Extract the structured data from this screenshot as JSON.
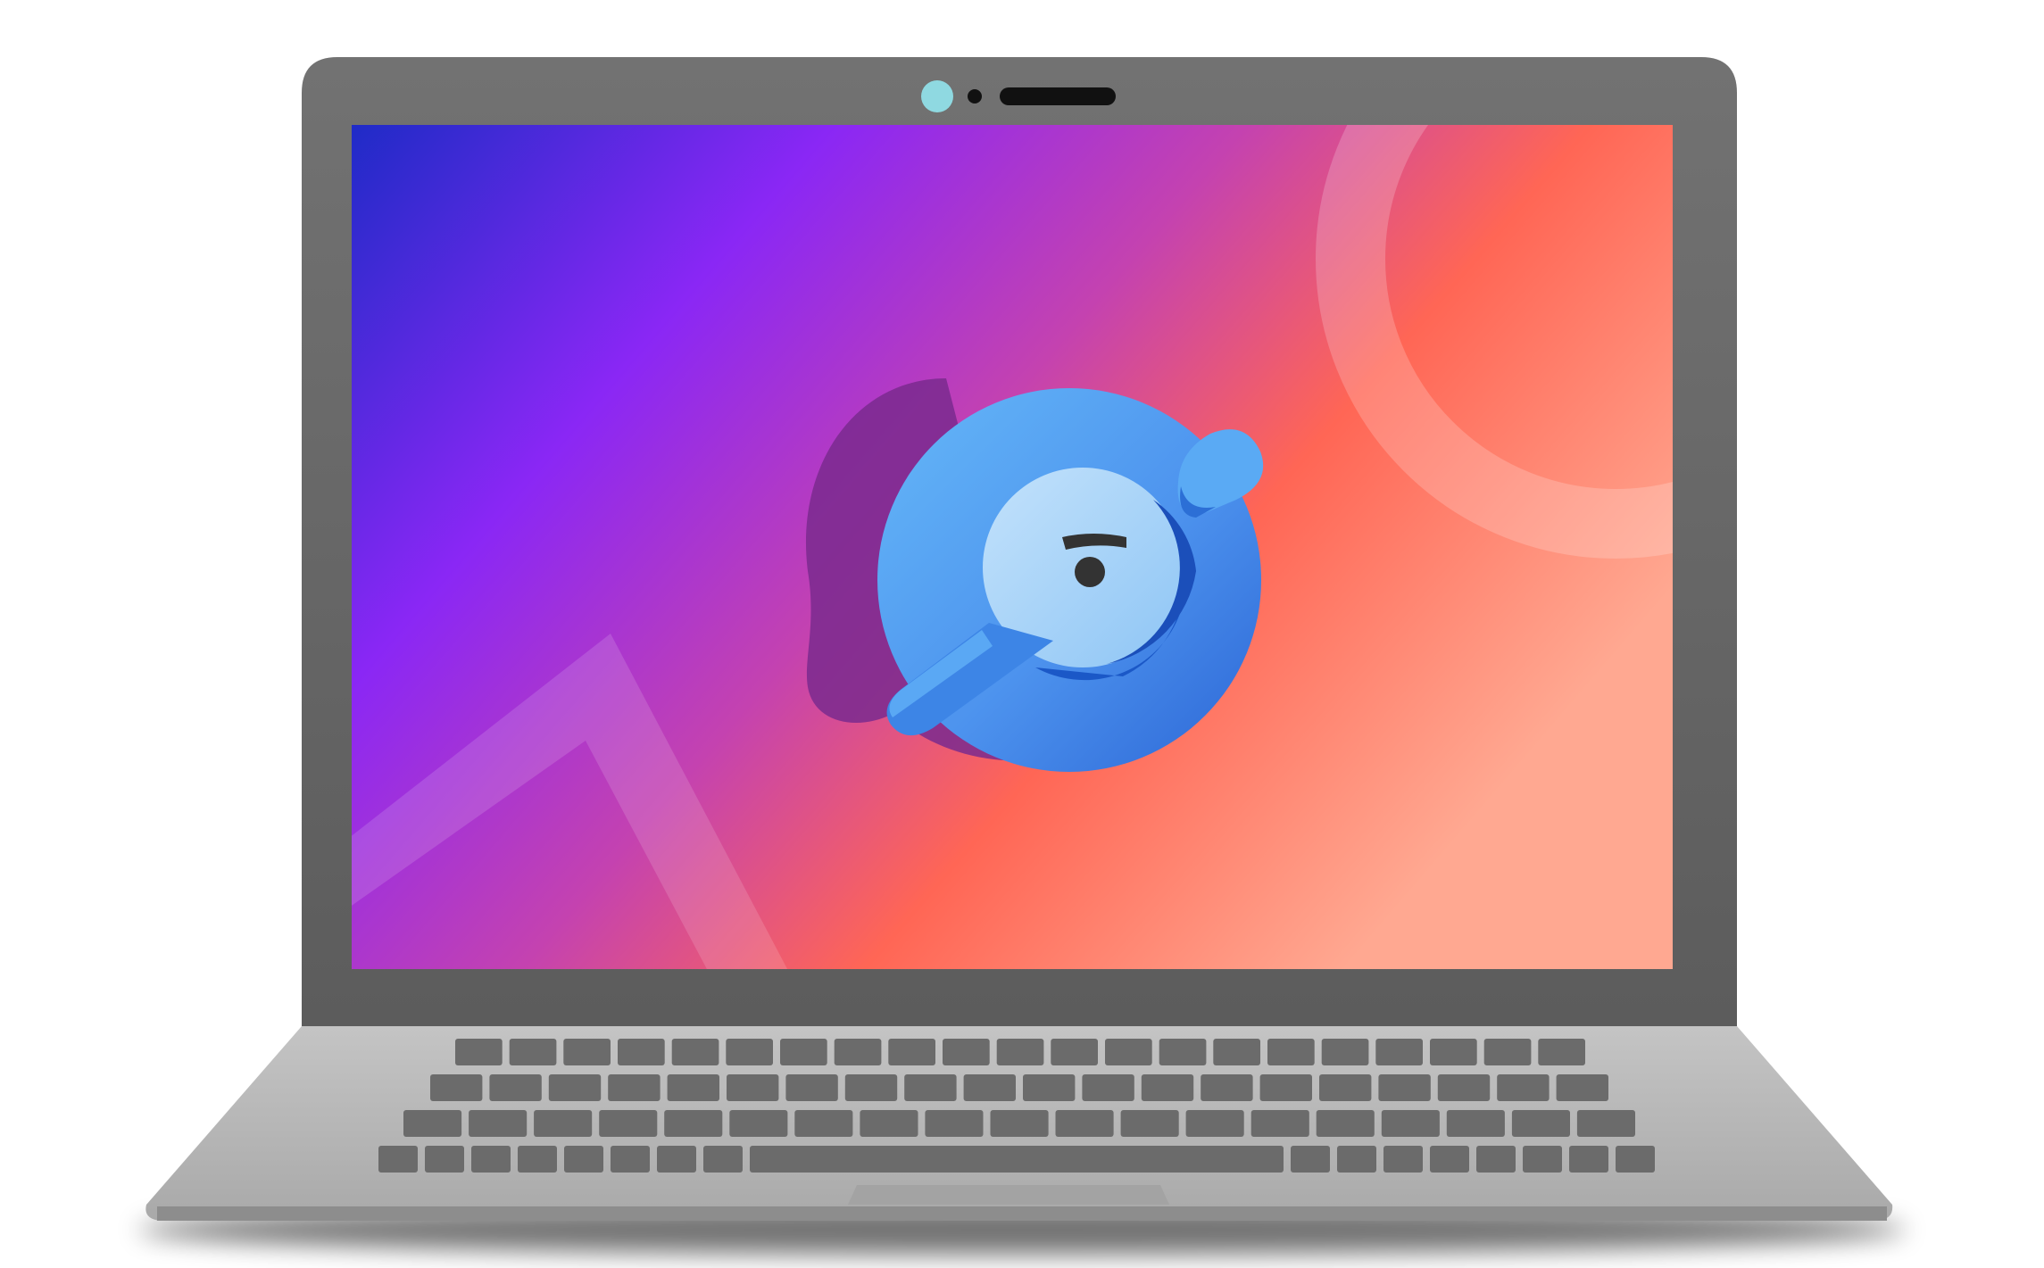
{
  "scene": {
    "device": "laptop",
    "screen": {
      "wallpaper": {
        "gradient_colors": [
          "#2430c8",
          "#8a27f5",
          "#c33fb5",
          "#ff6a55",
          "#ffa289"
        ],
        "decorations": [
          "ring-outline",
          "triangle-outline"
        ]
      },
      "app_icon": {
        "icon_name": "blue-round-dial-icon",
        "colors": {
          "outer": "#5fb2f6",
          "inner_face": "#9fcdf7",
          "dark_edge": "#1b58c7",
          "dot": "#333333",
          "shadow": "#7a2a8e"
        }
      }
    },
    "bezel": {
      "color": "#6b6b6b",
      "camera_colors": [
        "#8fd9e1",
        "#111111"
      ]
    },
    "base": {
      "color": "#b8b8b8",
      "key_color": "#6b6b6b",
      "trackpad_color": "#a8a8a8"
    }
  }
}
